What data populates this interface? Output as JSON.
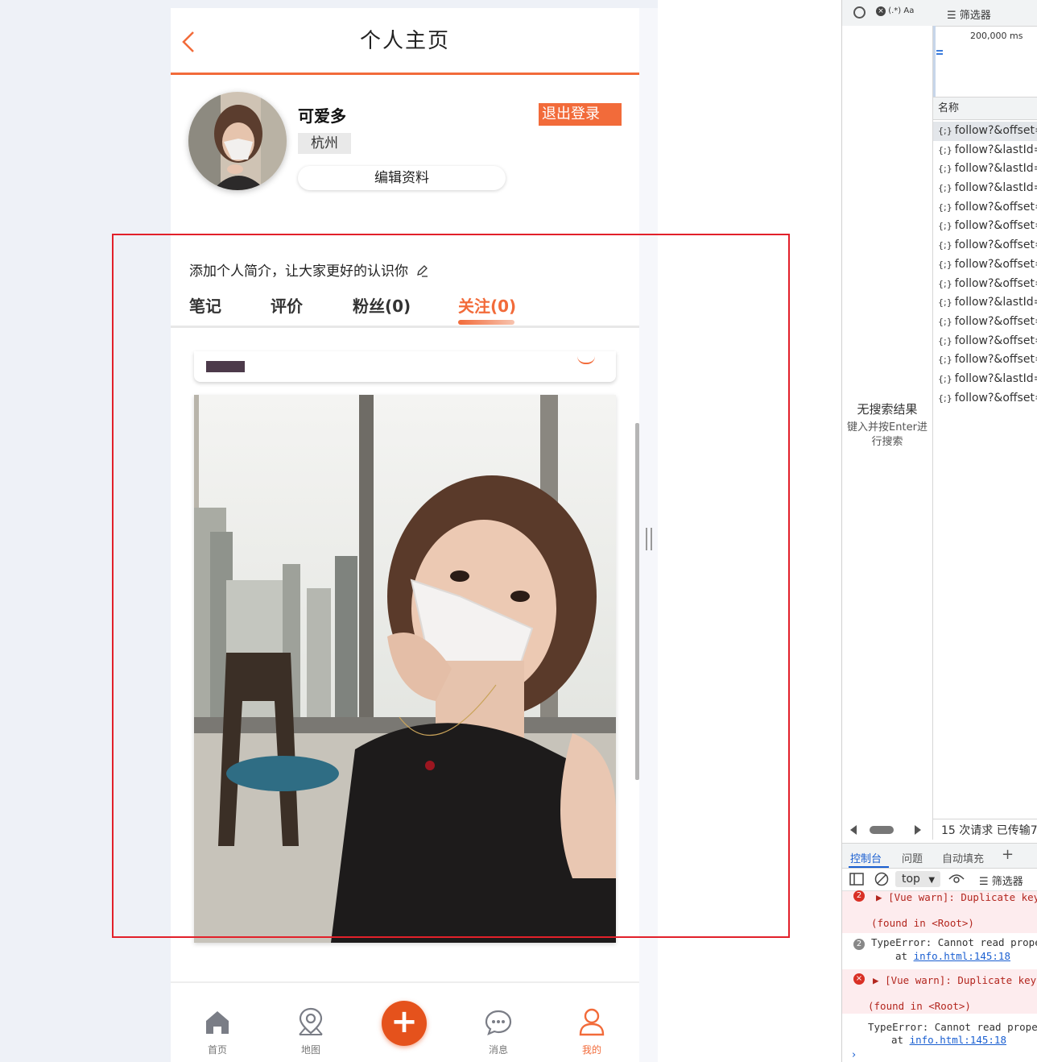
{
  "header": {
    "title": "个人主页"
  },
  "profile": {
    "name": "可爱多",
    "city": "杭州",
    "edit_label": "编辑资料",
    "logout_label": "退出登录",
    "intro_placeholder": "添加个人简介，让大家更好的认识你"
  },
  "tabs": [
    {
      "label": "笔记"
    },
    {
      "label": "评价"
    },
    {
      "label": "粉丝(0)"
    },
    {
      "label": "关注(0)"
    }
  ],
  "nav": {
    "items": [
      {
        "label": "首页"
      },
      {
        "label": "地图"
      },
      {
        "label": "消息"
      },
      {
        "label": "我的"
      }
    ],
    "plus": "+"
  },
  "colors": {
    "accent": "#f26b3a",
    "highlight": "#e2202a"
  },
  "devtools": {
    "regex_label": "(.*) Aa",
    "filter_label": "筛选器",
    "timeline_label": "200,000 ms",
    "no_results": "无搜索结果",
    "hint": "键入并按Enter进行搜索",
    "column_header": "名称",
    "requests": [
      "follow?&offset=",
      "follow?&lastId=",
      "follow?&lastId=",
      "follow?&lastId=",
      "follow?&offset=",
      "follow?&offset=",
      "follow?&offset=",
      "follow?&offset=",
      "follow?&offset=",
      "follow?&lastId=",
      "follow?&offset=",
      "follow?&offset=",
      "follow?&offset=",
      "follow?&lastId=",
      "follow?&offset="
    ],
    "status": "15 次请求   已传输7",
    "tabs": [
      "控制台",
      "问题",
      "自动填充"
    ],
    "context": "top",
    "console_filter": "筛选器",
    "messages": {
      "m1_count": "2",
      "m1_text": "[Vue warn]: Duplicate key",
      "m1_found": "(found in <Root>)",
      "m2_count": "2",
      "m2_text": "TypeError: Cannot read prope",
      "m2_at": "at ",
      "m2_link": "info.html:145:18",
      "m3_text": "[Vue warn]: Duplicate keys",
      "m3_found": "(found in <Root>)",
      "m4_text": "TypeError: Cannot read proper",
      "m4_at": "at ",
      "m4_link": "info.html:145:18"
    }
  }
}
